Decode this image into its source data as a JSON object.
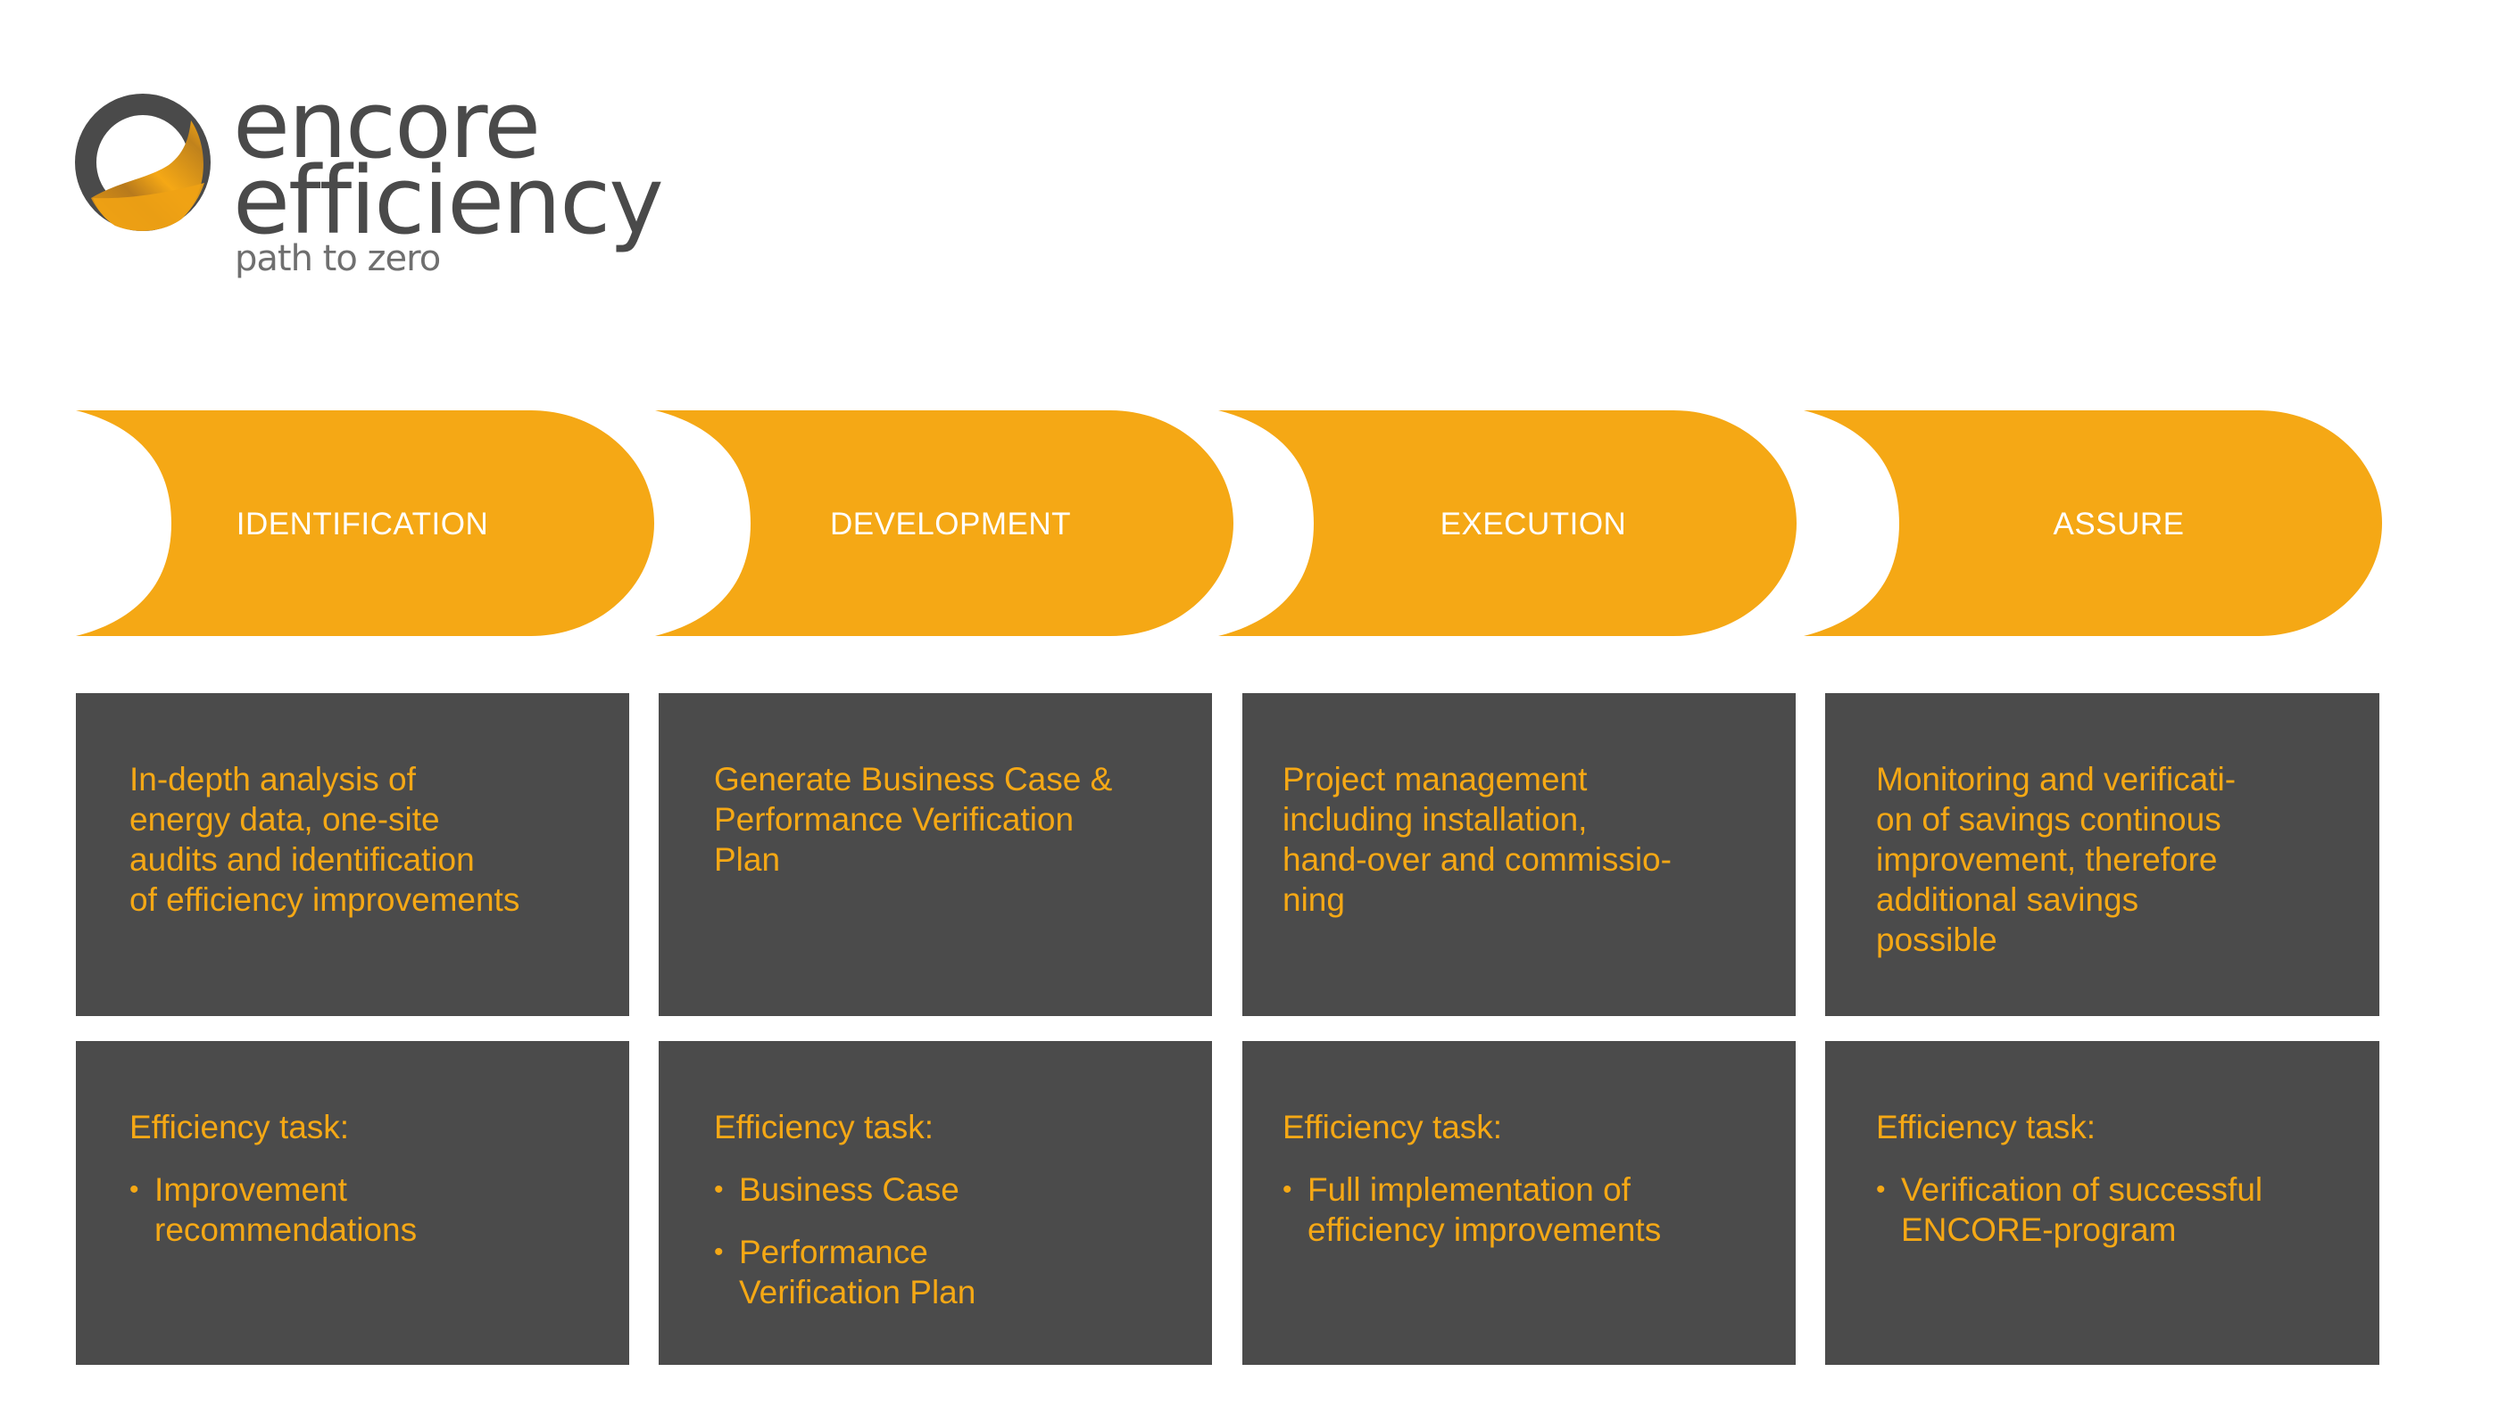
{
  "brand": {
    "line1": "encore",
    "line2": "efficiency",
    "tagline": "path to zero",
    "colors": {
      "orange": "#F5A815",
      "dark_gray": "#4B4B4B",
      "tagline_gray": "#6F6F6F",
      "white": "#FFFFFF"
    }
  },
  "phases": [
    {
      "label": "IDENTIFICATION",
      "description": "In-depth analysis of\nenergy data, one-site\naudits  and  identification\nof efficiency improvements",
      "task_title": "Efficiency task:",
      "tasks": [
        "Improvement\nrecommendations"
      ]
    },
    {
      "label": "DEVELOPMENT",
      "description": "Generate Business Case &\nPerformance Verification\nPlan",
      "task_title": "Efficiency task:",
      "tasks": [
        "Business Case",
        "Performance\nVerification Plan"
      ]
    },
    {
      "label": "EXECUTION",
      "description": "Project management\nincluding installation,\nhand-over and commissio-\nning",
      "task_title": "Efficiency task:",
      "tasks": [
        "Full implementation of\nefficiency improvements"
      ]
    },
    {
      "label": "ASSURE",
      "description": "Monitoring and verificati-\non of savings continous\nimprovement, therefore\nadditional savings\npossible",
      "task_title": "Efficiency task:",
      "tasks": [
        "Verification of successful\nENCORE-program"
      ]
    }
  ],
  "bullet_glyph": "•"
}
